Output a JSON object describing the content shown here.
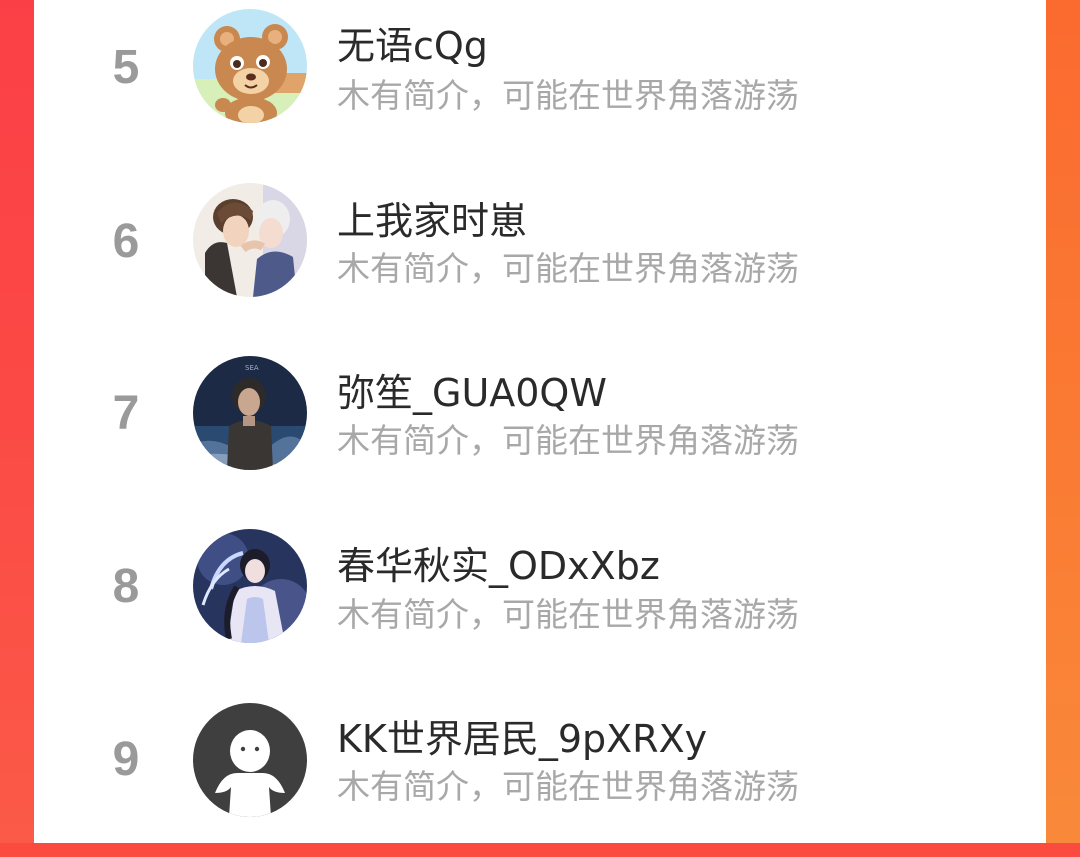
{
  "ranking_list": {
    "items": [
      {
        "rank": "5",
        "name": "无语cQg",
        "bio": "木有简介，可能在世界角落游荡",
        "avatar_icon": "bear-avatar-icon"
      },
      {
        "rank": "6",
        "name": "上我家时崽",
        "bio": "木有简介，可能在世界角落游荡",
        "avatar_icon": "anime-couple-avatar-icon"
      },
      {
        "rank": "7",
        "name": "弥笙_GUA0QW",
        "bio": "木有简介，可能在世界角落游荡",
        "avatar_icon": "dark-anime-avatar-icon"
      },
      {
        "rank": "8",
        "name": "春华秋实_ODxXbz",
        "bio": "木有简介，可能在世界角落游荡",
        "avatar_icon": "fantasy-girl-avatar-icon"
      },
      {
        "rank": "9",
        "name": "KK世界居民_9pXRXy",
        "bio": "木有简介，可能在世界角落游荡",
        "avatar_icon": "default-user-avatar-icon"
      }
    ]
  },
  "colors": {
    "background_red": "#fb4a3f",
    "background_orange": "#f96d37",
    "rank_gray": "#9a9a9a",
    "name_text": "#2a2a2a",
    "bio_text": "#a8a8a8"
  }
}
